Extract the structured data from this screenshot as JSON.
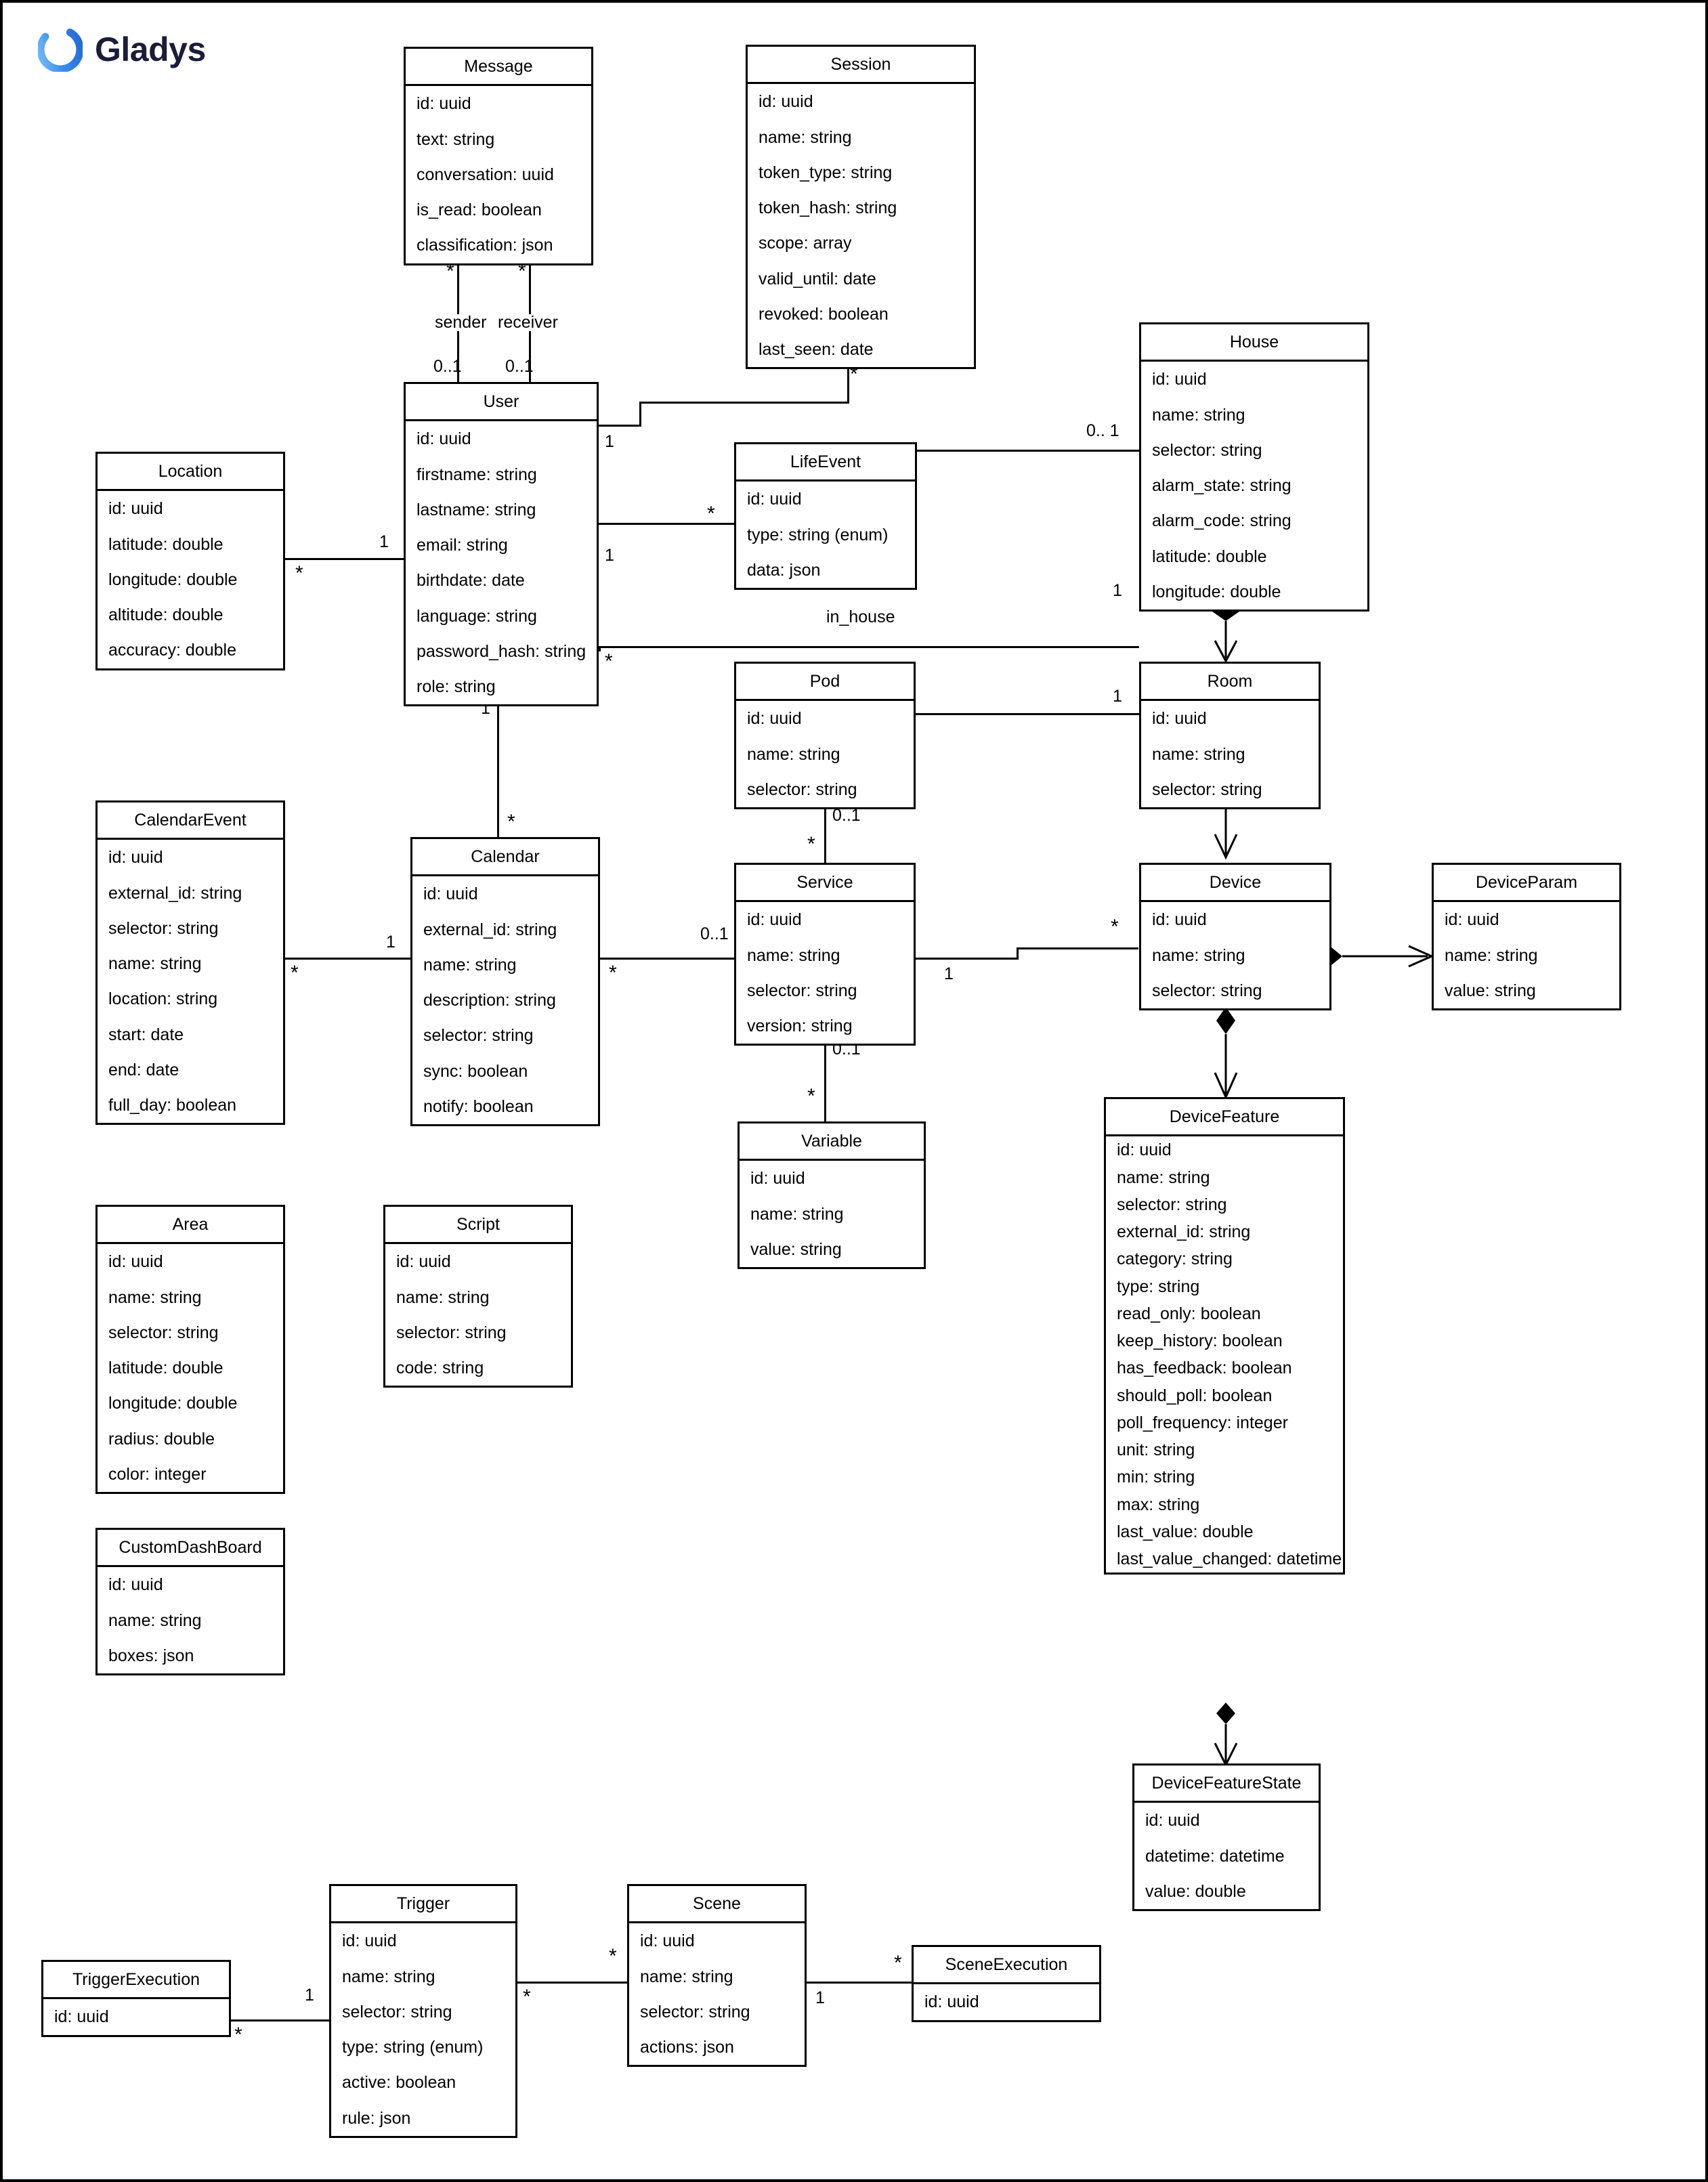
{
  "brand": {
    "name": "Gladys",
    "logo_icon": "gladys-ring-logo",
    "logo_color": "#3a8df0",
    "text_color": "#1b1c3a"
  },
  "diagram": {
    "type": "uml-class-diagram",
    "entities": [
      {
        "key": "message",
        "name": "Message",
        "attrs": [
          "id: uuid",
          "text: string",
          "conversation: uuid",
          "is_read: boolean",
          "classification: json"
        ]
      },
      {
        "key": "session",
        "name": "Session",
        "attrs": [
          "id: uuid",
          "name: string",
          "token_type: string",
          "token_hash: string",
          "scope: array",
          "valid_until: date",
          "revoked: boolean",
          "last_seen: date"
        ]
      },
      {
        "key": "house",
        "name": "House",
        "attrs": [
          "id: uuid",
          "name: string",
          "selector: string",
          "alarm_state: string",
          "alarm_code: string",
          "latitude: double",
          "longitude: double"
        ]
      },
      {
        "key": "user",
        "name": "User",
        "attrs": [
          "id: uuid",
          "firstname: string",
          "lastname: string",
          "email: string",
          "birthdate: date",
          "language: string",
          "password_hash: string",
          "role: string"
        ]
      },
      {
        "key": "location",
        "name": "Location",
        "attrs": [
          "id: uuid",
          "latitude: double",
          "longitude: double",
          "altitude: double",
          "accuracy: double"
        ]
      },
      {
        "key": "lifeevent",
        "name": "LifeEvent",
        "attrs": [
          "id: uuid",
          "type: string (enum)",
          "data: json"
        ]
      },
      {
        "key": "pod",
        "name": "Pod",
        "attrs": [
          "id: uuid",
          "name: string",
          "selector: string"
        ]
      },
      {
        "key": "room",
        "name": "Room",
        "attrs": [
          "id: uuid",
          "name: string",
          "selector: string"
        ]
      },
      {
        "key": "calendarevent",
        "name": "CalendarEvent",
        "attrs": [
          "id: uuid",
          "external_id: string",
          "selector: string",
          "name: string",
          "location: string",
          "start: date",
          "end: date",
          "full_day: boolean"
        ]
      },
      {
        "key": "calendar",
        "name": "Calendar",
        "attrs": [
          "id: uuid",
          "external_id: string",
          "name: string",
          "description: string",
          "selector: string",
          "sync: boolean",
          "notify: boolean"
        ]
      },
      {
        "key": "service",
        "name": "Service",
        "attrs": [
          "id: uuid",
          "name: string",
          "selector: string",
          "version: string"
        ]
      },
      {
        "key": "device",
        "name": "Device",
        "attrs": [
          "id: uuid",
          "name: string",
          "selector: string"
        ]
      },
      {
        "key": "deviceparam",
        "name": "DeviceParam",
        "attrs": [
          "id: uuid",
          "name: string",
          "value: string"
        ]
      },
      {
        "key": "variable",
        "name": "Variable",
        "attrs": [
          "id: uuid",
          "name: string",
          "value: string"
        ]
      },
      {
        "key": "devicefeature",
        "name": "DeviceFeature",
        "attrs": [
          "id: uuid",
          "name: string",
          "selector: string",
          "external_id: string",
          "category: string",
          "type: string",
          "read_only: boolean",
          "keep_history: boolean",
          "has_feedback: boolean",
          "should_poll: boolean",
          "poll_frequency: integer",
          "unit: string",
          "min: string",
          "max: string",
          "last_value: double",
          "last_value_changed: datetime"
        ]
      },
      {
        "key": "area",
        "name": "Area",
        "attrs": [
          "id: uuid",
          "name: string",
          "selector: string",
          "latitude: double",
          "longitude: double",
          "radius: double",
          "color: integer"
        ]
      },
      {
        "key": "script",
        "name": "Script",
        "attrs": [
          "id: uuid",
          "name: string",
          "selector: string",
          "code: string"
        ]
      },
      {
        "key": "customdashboard",
        "name": "CustomDashBoard",
        "attrs": [
          "id: uuid",
          "name: string",
          "boxes: json"
        ]
      },
      {
        "key": "devicefeaturestate",
        "name": "DeviceFeatureState",
        "attrs": [
          "id: uuid",
          "datetime: datetime",
          "value: double"
        ]
      },
      {
        "key": "triggerexecution",
        "name": "TriggerExecution",
        "attrs": [
          "id: uuid"
        ]
      },
      {
        "key": "trigger",
        "name": "Trigger",
        "attrs": [
          "id: uuid",
          "name: string",
          "selector: string",
          "type: string (enum)",
          "active: boolean",
          "rule: json"
        ]
      },
      {
        "key": "scene",
        "name": "Scene",
        "attrs": [
          "id: uuid",
          "name: string",
          "selector: string",
          "actions: json"
        ]
      },
      {
        "key": "sceneexecution",
        "name": "SceneExecution",
        "attrs": [
          "id: uuid"
        ]
      }
    ],
    "edge_labels": {
      "sender": "sender",
      "receiver": "receiver",
      "in_house": "in_house"
    },
    "multiplicities": {
      "many": "*",
      "one": "1",
      "zero_one": "0..1",
      "zero_space_one": "0.. 1"
    }
  }
}
